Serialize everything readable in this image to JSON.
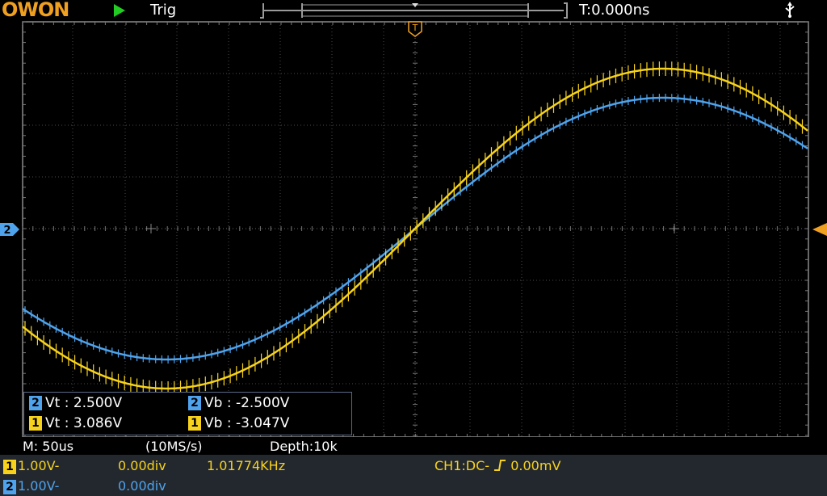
{
  "app": {
    "logo": "OWON"
  },
  "colors": {
    "ch1": "#f7d21c",
    "ch2": "#4fa3ec",
    "accent": "#f0a020",
    "run": "#22cc22",
    "grid": "#4a4a4a",
    "panel": "#23282f"
  },
  "header": {
    "run_state_icon": "play-icon",
    "trigger_status": "Trig",
    "trigger_time": "T:0.000ns",
    "usb_icon": "usb-icon"
  },
  "markers": {
    "trigger": "T",
    "ch2": "2"
  },
  "cursors": {
    "ch2": {
      "channel": "2",
      "vt": "Vt : 2.500V",
      "vb": "Vb : -2.500V"
    },
    "ch1": {
      "channel": "1",
      "vt": "Vt : 3.086V",
      "vb": "Vb : -3.047V"
    }
  },
  "status": {
    "timebase": "M: 50us",
    "sample_rate": "(10MS/s)",
    "depth": "Depth:10k"
  },
  "channels": [
    {
      "id": "1",
      "scale": "1.00V-",
      "offset": "0.00div",
      "frequency": "1.01774KHz",
      "trigger_info": "CH1:DC-",
      "trigger_level": "0.00mV"
    },
    {
      "id": "2",
      "scale": "1.00V-",
      "offset": "0.00div"
    }
  ]
}
